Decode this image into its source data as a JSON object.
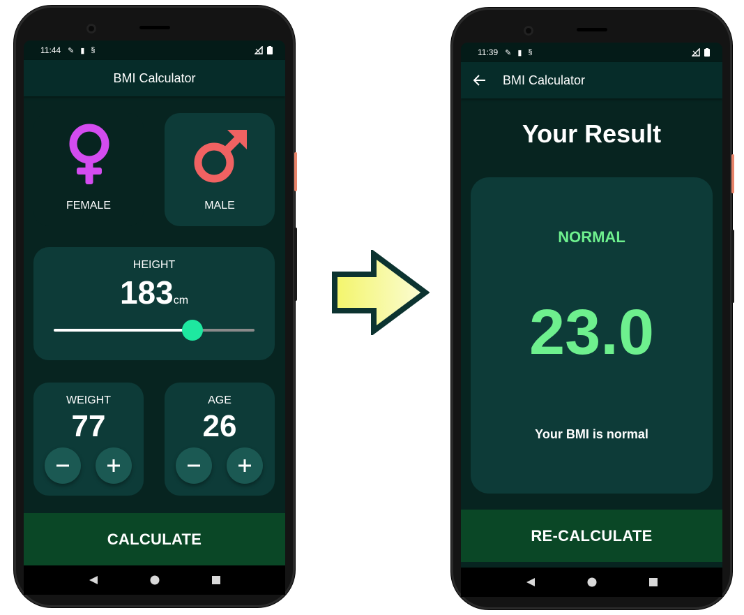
{
  "left_screen": {
    "status": {
      "time": "11:44"
    },
    "appbar_title": "BMI Calculator",
    "gender": {
      "female_label": "FEMALE",
      "male_label": "MALE",
      "selected": "male"
    },
    "height": {
      "label": "HEIGHT",
      "value": "183",
      "unit": "cm",
      "slider_fraction": 0.69
    },
    "weight": {
      "label": "WEIGHT",
      "value": "77"
    },
    "age": {
      "label": "AGE",
      "value": "26"
    },
    "button_label": "CALCULATE"
  },
  "right_screen": {
    "status": {
      "time": "11:39"
    },
    "appbar_title": "BMI Calculator",
    "heading": "Your Result",
    "result": {
      "category": "NORMAL",
      "bmi": "23.0",
      "message": "Your BMI is normal"
    },
    "button_label": "RE-CALCULATE"
  },
  "colors": {
    "background": "#072420",
    "card": "#0d3b38",
    "accent_green": "#6ef08e",
    "female_icon": "#d44cf0",
    "male_icon": "#f06262",
    "button": "#0a4726",
    "slider_thumb": "#1ee8a0"
  },
  "icons": [
    "female-symbol-icon",
    "male-symbol-icon",
    "minus-icon",
    "plus-icon",
    "back-arrow-icon",
    "arrow-right-icon"
  ]
}
